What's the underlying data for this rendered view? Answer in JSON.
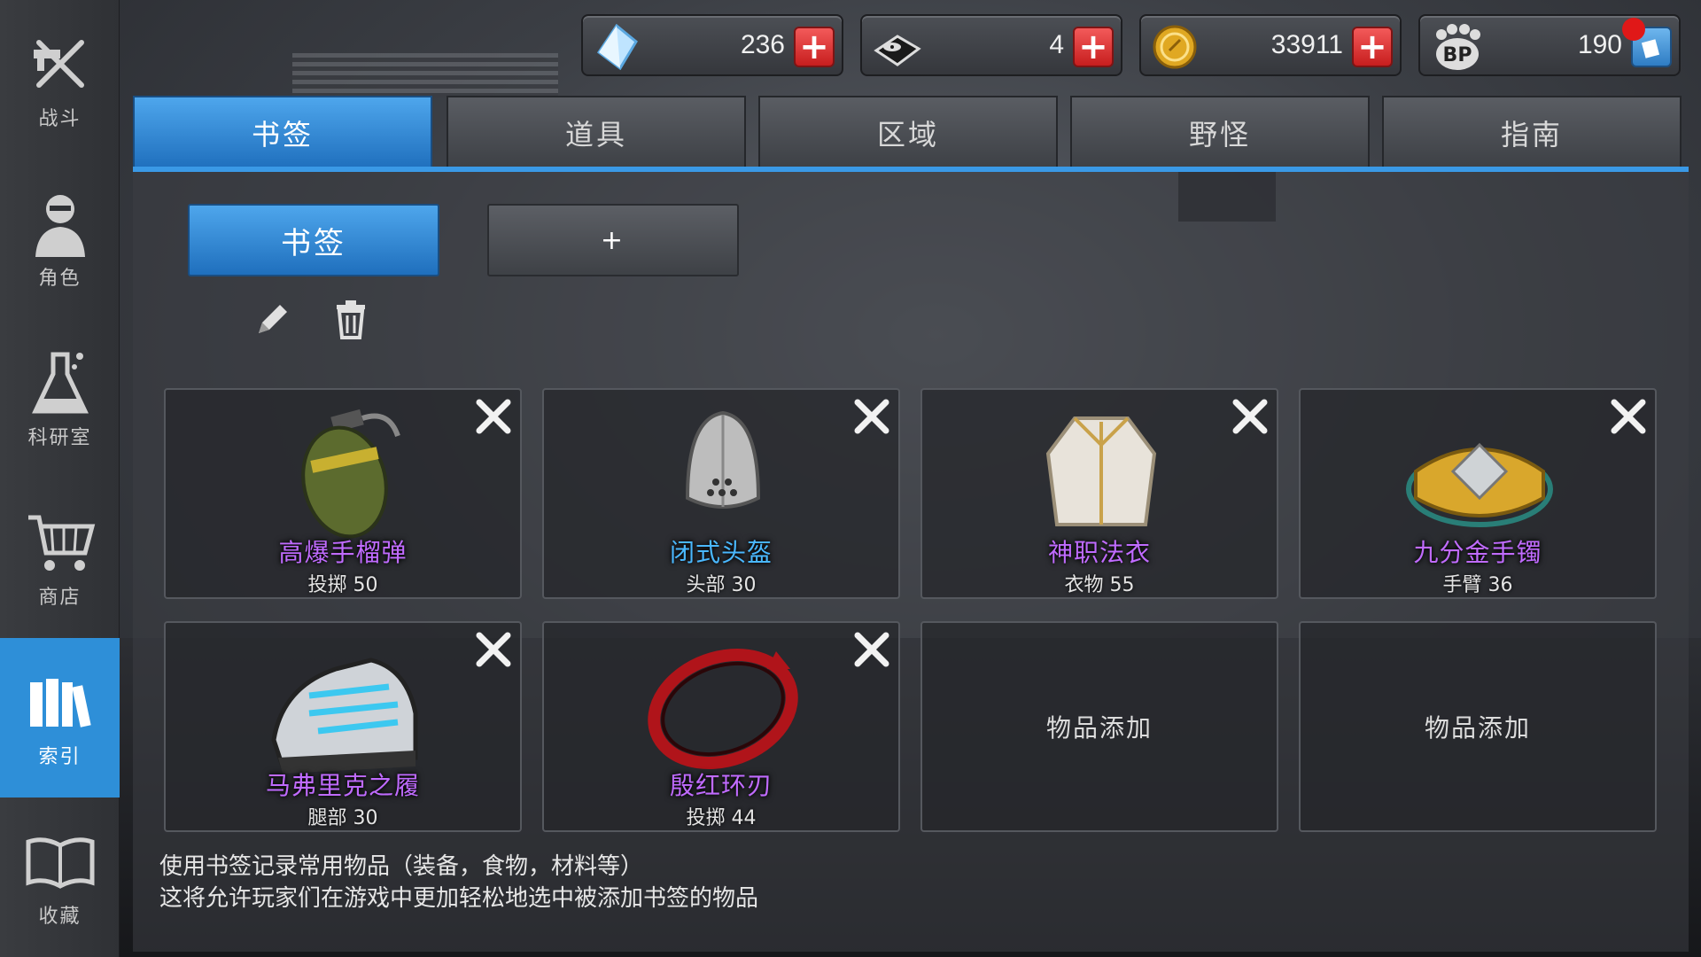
{
  "sidebar": {
    "items": [
      {
        "label": "战斗",
        "icon": "combat-icon"
      },
      {
        "label": "角色",
        "icon": "character-icon"
      },
      {
        "label": "科研室",
        "icon": "lab-flask-icon"
      },
      {
        "label": "商店",
        "icon": "shopping-cart-icon"
      },
      {
        "label": "索引",
        "icon": "index-books-icon",
        "active": true
      },
      {
        "label": "收藏",
        "icon": "open-book-icon"
      }
    ]
  },
  "currencies": [
    {
      "name": "crystal",
      "icon": "crystal-icon",
      "value": "236"
    },
    {
      "name": "disk",
      "icon": "disk-icon",
      "value": "4"
    },
    {
      "name": "coin",
      "icon": "gold-coin-icon",
      "value": "33911"
    },
    {
      "name": "bp",
      "icon": "bp-paw-icon",
      "value": "190"
    }
  ],
  "tabs": [
    {
      "label": "书签",
      "active": true
    },
    {
      "label": "道具"
    },
    {
      "label": "区域"
    },
    {
      "label": "野怪"
    },
    {
      "label": "指南"
    }
  ],
  "bookmark_tabs": {
    "active_label": "书签",
    "add_label": "+"
  },
  "items": [
    {
      "name": "高爆手榴弹",
      "sub": "投掷 50",
      "name_color": "#c06bff"
    },
    {
      "name": "闭式头盔",
      "sub": "头部 30",
      "name_color": "#4ab8ff"
    },
    {
      "name": "神职法衣",
      "sub": "衣物 55",
      "name_color": "#c06bff"
    },
    {
      "name": "九分金手镯",
      "sub": "手臂 36",
      "name_color": "#c06bff"
    },
    {
      "name": "马弗里克之履",
      "sub": "腿部 30",
      "name_color": "#c06bff"
    },
    {
      "name": "殷红环刃",
      "sub": "投掷 44",
      "name_color": "#c06bff"
    }
  ],
  "empty_slot_label": "物品添加",
  "footer": {
    "line1": "使用书签记录常用物品（装备，食物，材料等）",
    "line2": "这将允许玩家们在游戏中更加轻松地选中被添加书签的物品"
  },
  "colors": {
    "accent": "#2e8fd8",
    "plus_red": "#d82a2a",
    "rare_name": "#c06bff",
    "uncommon_name": "#4ab8ff"
  }
}
